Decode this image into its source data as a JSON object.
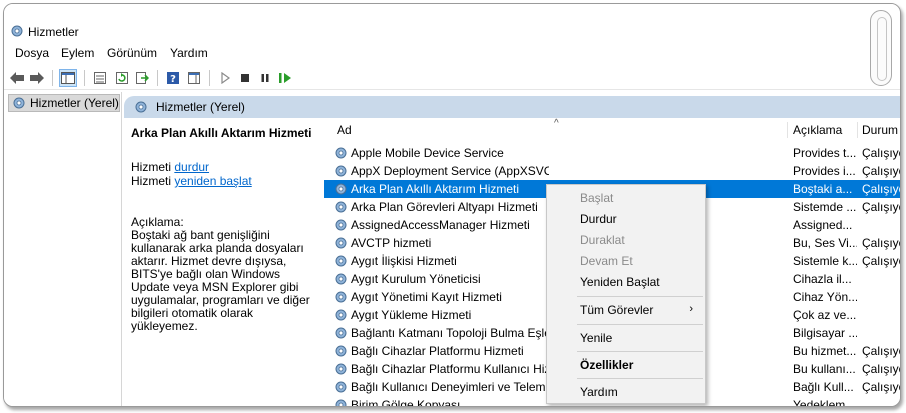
{
  "window": {
    "title": "Hizmetler"
  },
  "menu": [
    "Dosya",
    "Eylem",
    "Görünüm",
    "Yardım"
  ],
  "tree": {
    "root_label": "Hizmetler (Yerel)"
  },
  "panel": {
    "header": "Hizmetler (Yerel)"
  },
  "extended": {
    "title": "Arka Plan Akıllı Aktarım Hizmeti",
    "stop_prefix": "Hizmeti ",
    "stop_link": "durdur",
    "restart_prefix": "Hizmeti ",
    "restart_link": "yeniden başlat",
    "desc_label": "Açıklama:",
    "desc": "Boştaki ağ bant genişliğini kullanarak arka planda dosyaları aktarır. Hizmet devre dışıysa, BITS'ye bağlı olan Windows Update veya MSN Explorer gibi uygulamalar, programları ve diğer bilgileri otomatik olarak yükleyemez."
  },
  "columns": {
    "name": "Ad",
    "description": "Açıklama",
    "status": "Durum"
  },
  "services": [
    {
      "name": "Apple Mobile Device Service",
      "desc": "Provides t...",
      "status": "Çalışıyor"
    },
    {
      "name": "AppX Deployment Service (AppXSVC)",
      "desc": "Provides i...",
      "status": "Çalışıyor"
    },
    {
      "name": "Arka Plan Akıllı Aktarım Hizmeti",
      "desc": "Boştaki a...",
      "status": "Çalışıyor",
      "selected": true
    },
    {
      "name": "Arka Plan Görevleri Altyapı Hizmeti",
      "desc": "Sistemde ...",
      "status": "Çalışıyor"
    },
    {
      "name": "AssignedAccessManager Hizmeti",
      "desc": "Assigned...",
      "status": ""
    },
    {
      "name": "AVCTP hizmeti",
      "desc": "Bu, Ses Vi...",
      "status": "Çalışıyor"
    },
    {
      "name": "Aygıt İlişkisi Hizmeti",
      "desc": "Sistemle k...",
      "status": "Çalışıyor"
    },
    {
      "name": "Aygıt Kurulum Yöneticisi",
      "desc": "Cihazla il...",
      "status": ""
    },
    {
      "name": "Aygıt Yönetimi Kayıt Hizmeti",
      "desc": "Cihaz Yön...",
      "status": ""
    },
    {
      "name": "Aygıt Yükleme Hizmeti",
      "desc": "Çok az ve...",
      "status": ""
    },
    {
      "name": "Bağlantı Katmanı Topoloji Bulma Eşleyicisi",
      "desc": "Bilgisayar ...",
      "status": ""
    },
    {
      "name": "Bağlı Cihazlar Platformu Hizmeti",
      "desc": "Bu hizmet...",
      "status": "Çalışıyor"
    },
    {
      "name": "Bağlı Cihazlar Platformu Kullanıcı Hizmeti",
      "desc": "Bu kullanı...",
      "status": "Çalışıyor"
    },
    {
      "name": "Bağlı Kullanıcı Deneyimleri ve Telemetri",
      "desc": "Bağlı Kull...",
      "status": "Çalışıyor"
    },
    {
      "name": "Birim Gölge Kopyası",
      "desc": "Yedeklem...",
      "status": ""
    }
  ],
  "context_menu": {
    "start": "Başlat",
    "stop": "Durdur",
    "pause": "Duraklat",
    "resume": "Devam Et",
    "restart": "Yeniden Başlat",
    "all_tasks": "Tüm Görevler",
    "refresh": "Yenile",
    "properties": "Özellikler",
    "help": "Yardım"
  },
  "colors": {
    "selection": "#0078d7",
    "header_bg": "#c9d9ea",
    "link": "#0066cc"
  }
}
